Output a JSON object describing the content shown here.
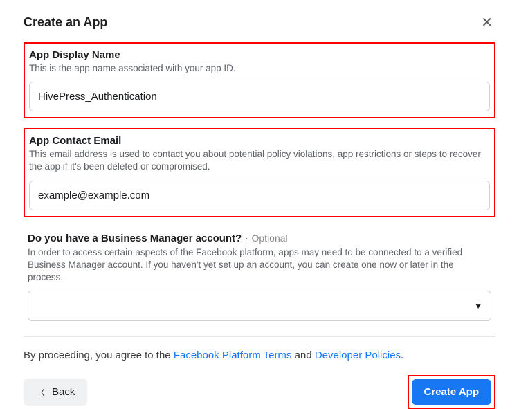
{
  "modal": {
    "title": "Create an App"
  },
  "displayName": {
    "label": "App Display Name",
    "desc": "This is the app name associated with your app ID.",
    "value": "HivePress_Authentication"
  },
  "contactEmail": {
    "label": "App Contact Email",
    "desc": "This email address is used to contact you about potential policy violations, app restrictions or steps to recover the app if it's been deleted or compromised.",
    "value": "example@example.com"
  },
  "businessManager": {
    "label": "Do you have a Business Manager account?",
    "optional": "Optional",
    "desc": "In order to access certain aspects of the Facebook platform, apps may need to be connected to a verified Business Manager account. If you haven't yet set up an account, you can create one now or later in the process.",
    "selected": ""
  },
  "terms": {
    "prefix": "By proceeding, you agree to the ",
    "link1": "Facebook Platform Terms",
    "mid": " and ",
    "link2": "Developer Policies",
    "suffix": "."
  },
  "footer": {
    "back": "Back",
    "create": "Create App"
  }
}
